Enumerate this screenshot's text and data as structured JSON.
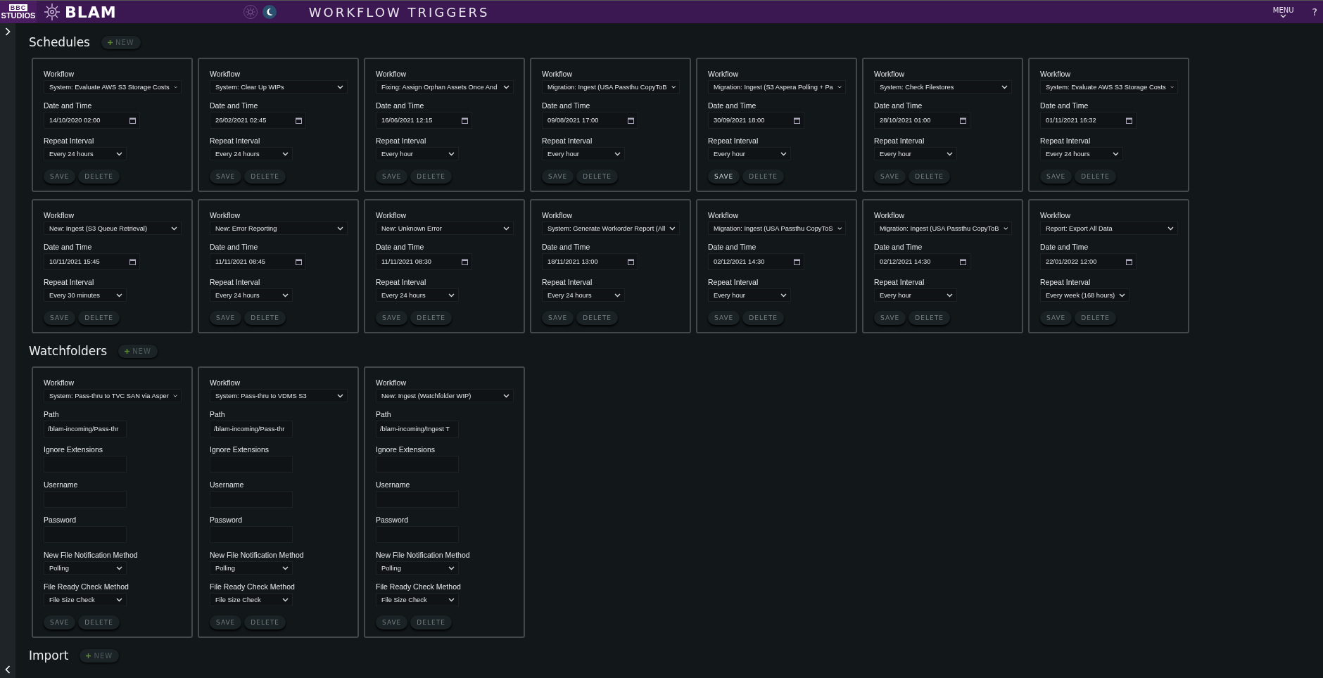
{
  "header": {
    "logo_top": "BBC",
    "logo_bottom": "STUDIOS",
    "app_name": "BLAM",
    "theme_options": [
      {
        "kind": "light",
        "selected": false
      },
      {
        "kind": "dark",
        "selected": true
      }
    ],
    "title": "WORKFLOW TRIGGERS",
    "menu": "MENU",
    "help": "?"
  },
  "sections": [
    {
      "title": "Schedules",
      "new_label": "NEW",
      "cards": [
        {
          "fields": [
            {
              "kind": "select",
              "label": "Workflow",
              "value": "System: Evaluate AWS S3 Storage Costs"
            },
            {
              "kind": "date",
              "label": "Date and Time",
              "value": "14/10/2020 02:00"
            },
            {
              "kind": "select",
              "label": "Repeat Interval",
              "value": "Every 24 hours"
            }
          ],
          "buttons": [
            {
              "label": "SAVE",
              "disabled": true
            },
            {
              "label": "DELETE",
              "disabled": true
            }
          ]
        },
        {
          "fields": [
            {
              "kind": "select",
              "label": "Workflow",
              "value": "System: Clear Up WIPs"
            },
            {
              "kind": "date",
              "label": "Date and Time",
              "value": "26/02/2021 02:45"
            },
            {
              "kind": "select",
              "label": "Repeat Interval",
              "value": "Every 24 hours"
            }
          ],
          "buttons": [
            {
              "label": "SAVE",
              "disabled": true
            },
            {
              "label": "DELETE",
              "disabled": true
            }
          ]
        },
        {
          "fields": [
            {
              "kind": "select",
              "label": "Workflow",
              "value": "Fixing: Assign Orphan Assets Once And"
            },
            {
              "kind": "date",
              "label": "Date and Time",
              "value": "16/06/2021 12:15"
            },
            {
              "kind": "select",
              "label": "Repeat Interval",
              "value": "Every hour"
            }
          ],
          "buttons": [
            {
              "label": "SAVE",
              "disabled": true
            },
            {
              "label": "DELETE",
              "disabled": true
            }
          ]
        },
        {
          "fields": [
            {
              "kind": "select",
              "label": "Workflow",
              "value": "Migration: Ingest (USA Passthu CopyToB"
            },
            {
              "kind": "date",
              "label": "Date and Time",
              "value": "09/08/2021 17:00"
            },
            {
              "kind": "select",
              "label": "Repeat Interval",
              "value": "Every hour"
            }
          ],
          "buttons": [
            {
              "label": "SAVE",
              "disabled": true
            },
            {
              "label": "DELETE",
              "disabled": true
            }
          ]
        },
        {
          "fields": [
            {
              "kind": "select",
              "label": "Workflow",
              "value": "Migration: Ingest (S3 Aspera Polling + Pa"
            },
            {
              "kind": "date",
              "label": "Date and Time",
              "value": "30/09/2021 18:00"
            },
            {
              "kind": "select",
              "label": "Repeat Interval",
              "value": "Every hour"
            }
          ],
          "buttons": [
            {
              "label": "SAVE",
              "disabled": false
            },
            {
              "label": "DELETE",
              "disabled": true
            }
          ]
        },
        {
          "fields": [
            {
              "kind": "select",
              "label": "Workflow",
              "value": "System: Check Filestores"
            },
            {
              "kind": "date",
              "label": "Date and Time",
              "value": "28/10/2021 01:00"
            },
            {
              "kind": "select",
              "label": "Repeat Interval",
              "value": "Every hour"
            }
          ],
          "buttons": [
            {
              "label": "SAVE",
              "disabled": true
            },
            {
              "label": "DELETE",
              "disabled": true
            }
          ]
        },
        {
          "fields": [
            {
              "kind": "select",
              "label": "Workflow",
              "value": "System: Evaluate AWS S3 Storage Costs"
            },
            {
              "kind": "date",
              "label": "Date and Time",
              "value": "01/11/2021 16:32"
            },
            {
              "kind": "select",
              "label": "Repeat Interval",
              "value": "Every 24 hours"
            }
          ],
          "buttons": [
            {
              "label": "SAVE",
              "disabled": true
            },
            {
              "label": "DELETE",
              "disabled": true
            }
          ]
        },
        {
          "fields": [
            {
              "kind": "select",
              "label": "Workflow",
              "value": "New: Ingest (S3 Queue Retrieval)"
            },
            {
              "kind": "date",
              "label": "Date and Time",
              "value": "10/11/2021 15:45"
            },
            {
              "kind": "select",
              "label": "Repeat Interval",
              "value": "Every 30 minutes"
            }
          ],
          "buttons": [
            {
              "label": "SAVE",
              "disabled": true
            },
            {
              "label": "DELETE",
              "disabled": true
            }
          ]
        },
        {
          "fields": [
            {
              "kind": "select",
              "label": "Workflow",
              "value": "New: Error Reporting"
            },
            {
              "kind": "date",
              "label": "Date and Time",
              "value": "11/11/2021 08:45"
            },
            {
              "kind": "select",
              "label": "Repeat Interval",
              "value": "Every 24 hours"
            }
          ],
          "buttons": [
            {
              "label": "SAVE",
              "disabled": true
            },
            {
              "label": "DELETE",
              "disabled": true
            }
          ]
        },
        {
          "fields": [
            {
              "kind": "select",
              "label": "Workflow",
              "value": "New: Unknown Error"
            },
            {
              "kind": "date",
              "label": "Date and Time",
              "value": "11/11/2021 08:30"
            },
            {
              "kind": "select",
              "label": "Repeat Interval",
              "value": "Every 24 hours"
            }
          ],
          "buttons": [
            {
              "label": "SAVE",
              "disabled": true
            },
            {
              "label": "DELETE",
              "disabled": true
            }
          ]
        },
        {
          "fields": [
            {
              "kind": "select",
              "label": "Workflow",
              "value": "System: Generate Workorder Report (All"
            },
            {
              "kind": "date",
              "label": "Date and Time",
              "value": "18/11/2021 13:00"
            },
            {
              "kind": "select",
              "label": "Repeat Interval",
              "value": "Every 24 hours"
            }
          ],
          "buttons": [
            {
              "label": "SAVE",
              "disabled": true
            },
            {
              "label": "DELETE",
              "disabled": true
            }
          ]
        },
        {
          "fields": [
            {
              "kind": "select",
              "label": "Workflow",
              "value": "Migration: Ingest (USA Passthu CopyToS"
            },
            {
              "kind": "date",
              "label": "Date and Time",
              "value": "02/12/2021 14:30"
            },
            {
              "kind": "select",
              "label": "Repeat Interval",
              "value": "Every hour"
            }
          ],
          "buttons": [
            {
              "label": "SAVE",
              "disabled": true
            },
            {
              "label": "DELETE",
              "disabled": true
            }
          ]
        },
        {
          "fields": [
            {
              "kind": "select",
              "label": "Workflow",
              "value": "Migration: Ingest (USA Passthu CopyToB"
            },
            {
              "kind": "date",
              "label": "Date and Time",
              "value": "02/12/2021 14:30"
            },
            {
              "kind": "select",
              "label": "Repeat Interval",
              "value": "Every hour"
            }
          ],
          "buttons": [
            {
              "label": "SAVE",
              "disabled": true
            },
            {
              "label": "DELETE",
              "disabled": true
            }
          ]
        },
        {
          "fields": [
            {
              "kind": "select",
              "label": "Workflow",
              "value": "Report: Export All Data"
            },
            {
              "kind": "date",
              "label": "Date and Time",
              "value": "22/01/2022 12:00"
            },
            {
              "kind": "select",
              "label": "Repeat Interval",
              "value": "Every week (168 hours)"
            }
          ],
          "buttons": [
            {
              "label": "SAVE",
              "disabled": true
            },
            {
              "label": "DELETE",
              "disabled": true
            }
          ]
        }
      ]
    },
    {
      "title": "Watchfolders",
      "new_label": "NEW",
      "cards": [
        {
          "fields": [
            {
              "kind": "select",
              "label": "Workflow",
              "value": "System: Pass-thru to TVC SAN via Asper"
            },
            {
              "kind": "text",
              "label": "Path",
              "value": "/blam-incoming/Pass-thr"
            },
            {
              "kind": "text",
              "label": "Ignore Extensions"
            },
            {
              "kind": "text",
              "label": "Username"
            },
            {
              "kind": "password",
              "label": "Password"
            },
            {
              "kind": "select",
              "label": "New File Notification Method",
              "value": "Polling"
            },
            {
              "kind": "select",
              "label": "File Ready Check Method",
              "value": "File Size Check"
            }
          ],
          "buttons": [
            {
              "label": "SAVE",
              "disabled": true
            },
            {
              "label": "DELETE",
              "disabled": true
            }
          ]
        },
        {
          "fields": [
            {
              "kind": "select",
              "label": "Workflow",
              "value": "System: Pass-thru to VDMS S3"
            },
            {
              "kind": "text",
              "label": "Path",
              "value": "/blam-incoming/Pass-thr"
            },
            {
              "kind": "text",
              "label": "Ignore Extensions"
            },
            {
              "kind": "text",
              "label": "Username"
            },
            {
              "kind": "password",
              "label": "Password"
            },
            {
              "kind": "select",
              "label": "New File Notification Method",
              "value": "Polling"
            },
            {
              "kind": "select",
              "label": "File Ready Check Method",
              "value": "File Size Check"
            }
          ],
          "buttons": [
            {
              "label": "SAVE",
              "disabled": true
            },
            {
              "label": "DELETE",
              "disabled": true
            }
          ]
        },
        {
          "fields": [
            {
              "kind": "select",
              "label": "Workflow",
              "value": "New: Ingest (Watchfolder WIP)"
            },
            {
              "kind": "text",
              "label": "Path",
              "value": "/blam-incoming/Ingest T"
            },
            {
              "kind": "text",
              "label": "Ignore Extensions"
            },
            {
              "kind": "text",
              "label": "Username"
            },
            {
              "kind": "password",
              "label": "Password"
            },
            {
              "kind": "select",
              "label": "New File Notification Method",
              "value": "Polling"
            },
            {
              "kind": "select",
              "label": "File Ready Check Method",
              "value": "File Size Check"
            }
          ],
          "buttons": [
            {
              "label": "SAVE",
              "disabled": true
            },
            {
              "label": "DELETE",
              "disabled": true
            }
          ]
        }
      ]
    },
    {
      "title": "Import",
      "new_label": "NEW"
    }
  ]
}
